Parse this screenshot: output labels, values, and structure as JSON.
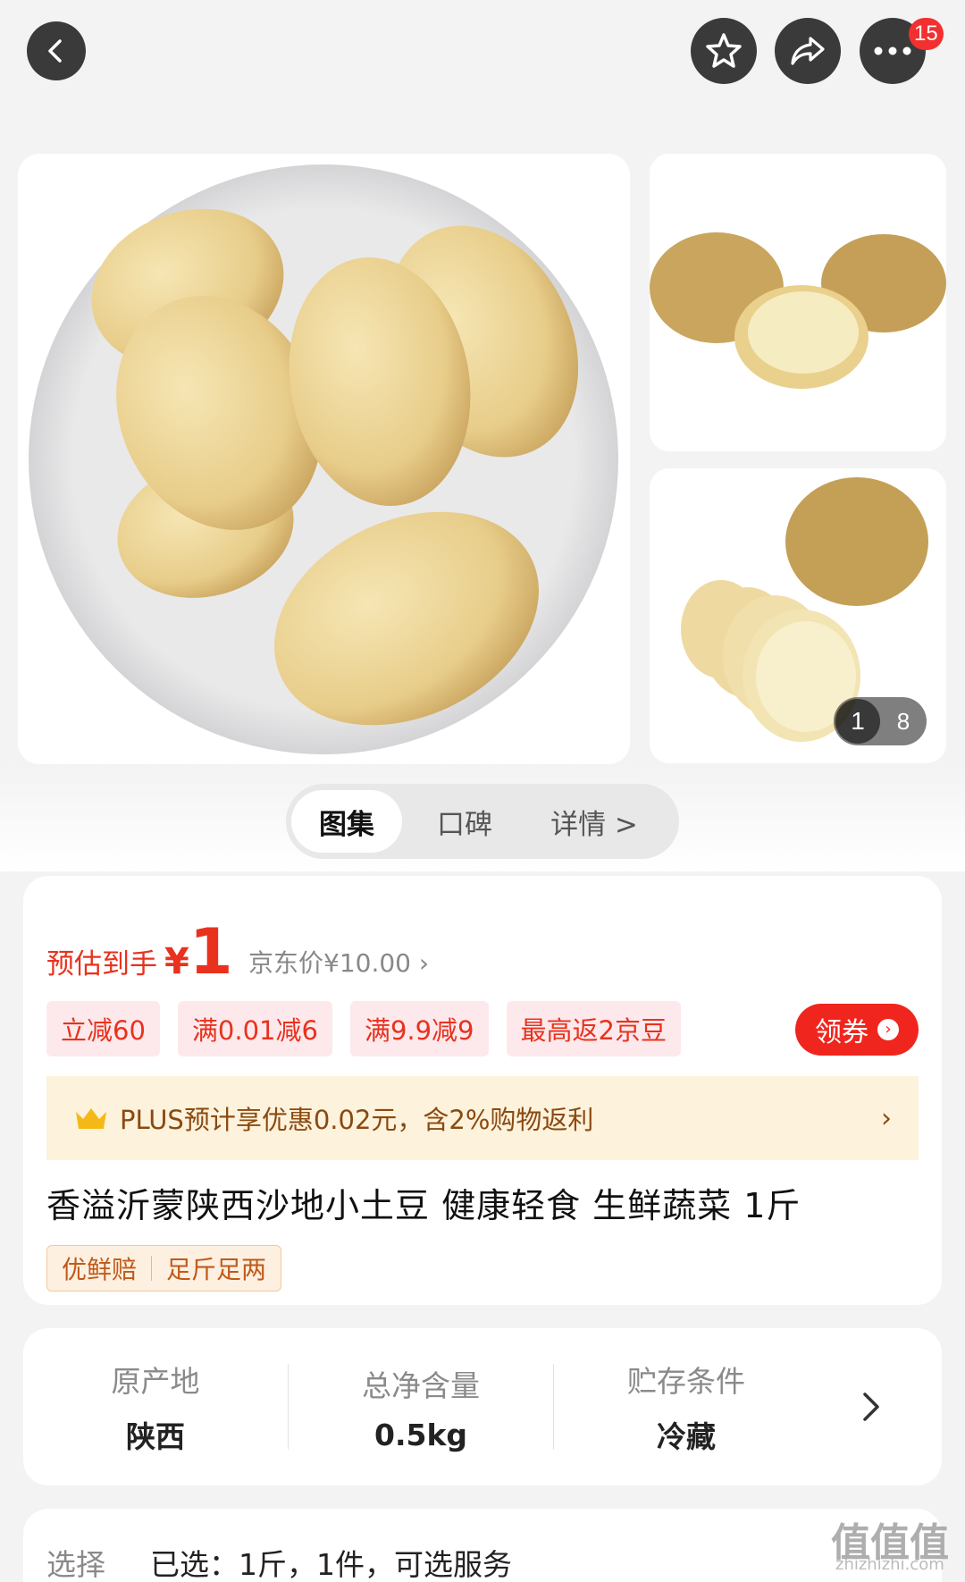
{
  "topbar": {
    "cart_badge_count": "15"
  },
  "gallery": {
    "current_index": "1",
    "total_count": "8"
  },
  "tabs": [
    {
      "label": "图集"
    },
    {
      "label": "口碑"
    },
    {
      "label": "详情 >"
    }
  ],
  "price": {
    "estimate_label": "预估到手",
    "currency": "¥",
    "estimate_value": "1",
    "jd_price_text": "京东价¥10.00 ›",
    "accent_color": "#e8321e"
  },
  "promo_tags": [
    {
      "label": "立减60"
    },
    {
      "label": "满0.01减6"
    },
    {
      "label": "满9.9减9"
    },
    {
      "label": "最高返2京豆"
    }
  ],
  "coupon_button": {
    "label": "领券"
  },
  "plus_bar": {
    "text": "PLUS预计享优惠0.02元，含2%购物返利",
    "arrow": "›"
  },
  "product": {
    "title": "香溢沂蒙陕西沙地小土豆 健康轻食 生鲜蔬菜 1斤",
    "service_tags": [
      "优鲜赔",
      "足斤足两"
    ]
  },
  "attributes": [
    {
      "key": "原产地",
      "value": "陕西"
    },
    {
      "key": "总净含量",
      "value": "0.5kg"
    },
    {
      "key": "贮存条件",
      "value": "冷藏"
    }
  ],
  "selection": {
    "label": "选择",
    "value": "已选：1斤，1件，可选服务"
  },
  "watermark": {
    "text": "值值值",
    "url": "zhizhizhi.com"
  }
}
